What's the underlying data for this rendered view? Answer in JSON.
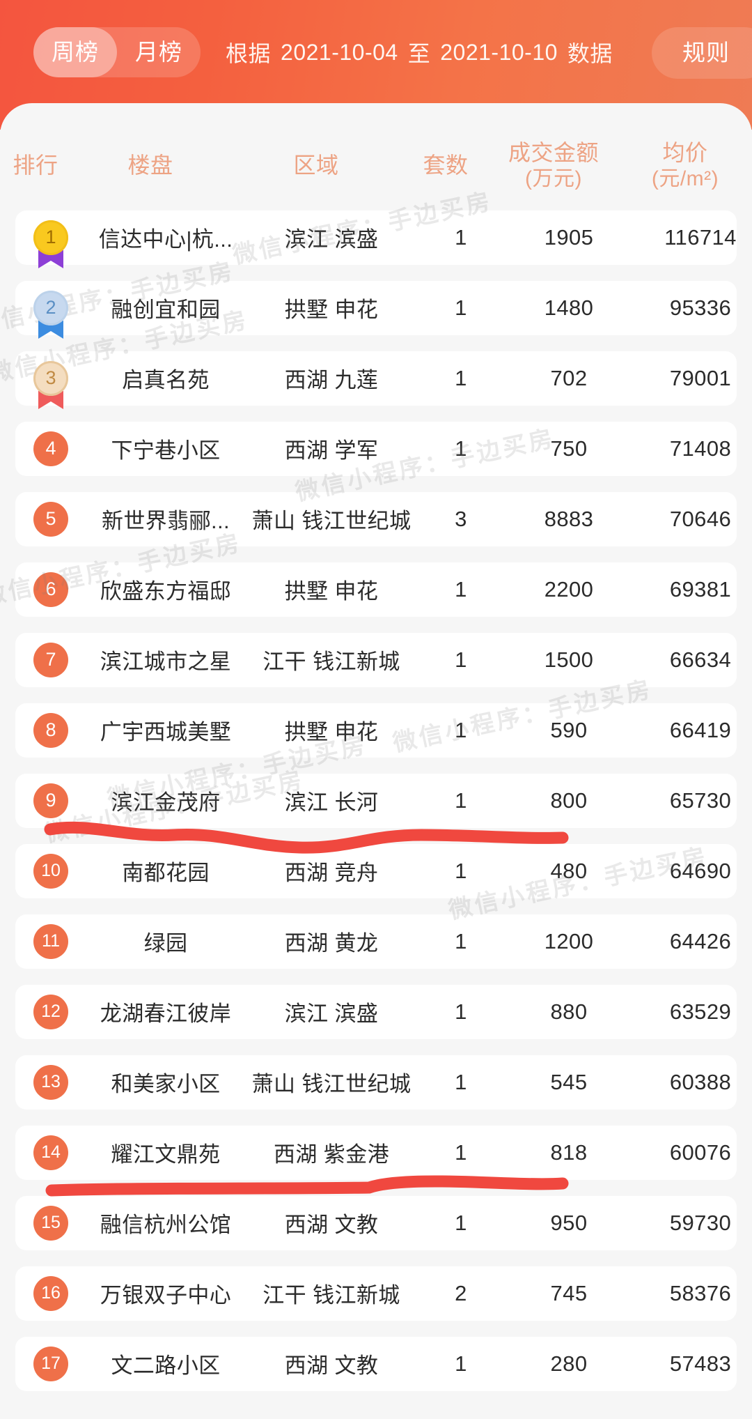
{
  "header": {
    "tabs": [
      {
        "label": "周榜",
        "active": true
      },
      {
        "label": "月榜",
        "active": false
      }
    ],
    "range_prefix": "根据",
    "date_from": "2021-10-04",
    "range_middle": "至",
    "date_to": "2021-10-10",
    "range_suffix": "数据",
    "rule_label": "规则",
    "accent_start": "#f4553f",
    "accent_end": "#ef7b54"
  },
  "table": {
    "columns": [
      {
        "label": "排行",
        "sub": ""
      },
      {
        "label": "楼盘",
        "sub": ""
      },
      {
        "label": "区域",
        "sub": ""
      },
      {
        "label": "套数",
        "sub": ""
      },
      {
        "label": "成交金额",
        "sub": "(万元)"
      },
      {
        "label": "均价",
        "sub": "(元/m²)"
      }
    ],
    "header_color": "#eda384",
    "rows": [
      {
        "rank": "1",
        "badge": "medal-gold",
        "name": "信达中心|杭...",
        "area": "滨江 滨盛",
        "units": "1",
        "amount": "1905",
        "price": "116714"
      },
      {
        "rank": "2",
        "badge": "medal-silver",
        "name": "融创宜和园",
        "area": "拱墅 申花",
        "units": "1",
        "amount": "1480",
        "price": "95336"
      },
      {
        "rank": "3",
        "badge": "medal-bronze",
        "name": "启真名苑",
        "area": "西湖 九莲",
        "units": "1",
        "amount": "702",
        "price": "79001"
      },
      {
        "rank": "4",
        "badge": "circle",
        "name": "下宁巷小区",
        "area": "西湖 学军",
        "units": "1",
        "amount": "750",
        "price": "71408"
      },
      {
        "rank": "5",
        "badge": "circle",
        "name": "新世界翡郦...",
        "area": "萧山 钱江世纪城",
        "units": "3",
        "amount": "8883",
        "price": "70646"
      },
      {
        "rank": "6",
        "badge": "circle",
        "name": "欣盛东方福邸",
        "area": "拱墅 申花",
        "units": "1",
        "amount": "2200",
        "price": "69381"
      },
      {
        "rank": "7",
        "badge": "circle",
        "name": "滨江城市之星",
        "area": "江干 钱江新城",
        "units": "1",
        "amount": "1500",
        "price": "66634"
      },
      {
        "rank": "8",
        "badge": "circle",
        "name": "广宇西城美墅",
        "area": "拱墅 申花",
        "units": "1",
        "amount": "590",
        "price": "66419"
      },
      {
        "rank": "9",
        "badge": "circle",
        "name": "滨江金茂府",
        "area": "滨江 长河",
        "units": "1",
        "amount": "800",
        "price": "65730"
      },
      {
        "rank": "10",
        "badge": "circle",
        "name": "南都花园",
        "area": "西湖 竞舟",
        "units": "1",
        "amount": "480",
        "price": "64690"
      },
      {
        "rank": "11",
        "badge": "circle",
        "name": "绿园",
        "area": "西湖 黄龙",
        "units": "1",
        "amount": "1200",
        "price": "64426"
      },
      {
        "rank": "12",
        "badge": "circle",
        "name": "龙湖春江彼岸",
        "area": "滨江 滨盛",
        "units": "1",
        "amount": "880",
        "price": "63529"
      },
      {
        "rank": "13",
        "badge": "circle",
        "name": "和美家小区",
        "area": "萧山 钱江世纪城",
        "units": "1",
        "amount": "545",
        "price": "60388"
      },
      {
        "rank": "14",
        "badge": "circle",
        "name": "耀江文鼎苑",
        "area": "西湖 紫金港",
        "units": "1",
        "amount": "818",
        "price": "60076"
      },
      {
        "rank": "15",
        "badge": "circle",
        "name": "融信杭州公馆",
        "area": "西湖 文教",
        "units": "1",
        "amount": "950",
        "price": "59730"
      },
      {
        "rank": "16",
        "badge": "circle",
        "name": "万银双子中心",
        "area": "江干 钱江新城",
        "units": "2",
        "amount": "745",
        "price": "58376"
      },
      {
        "rank": "17",
        "badge": "circle",
        "name": "文二路小区",
        "area": "西湖 文教",
        "units": "1",
        "amount": "280",
        "price": "57483"
      }
    ]
  },
  "watermark": {
    "text": "微信小程序：手边买房"
  },
  "annotations": {
    "color": "#f0483f",
    "underline_rows": [
      "9",
      "14"
    ]
  }
}
